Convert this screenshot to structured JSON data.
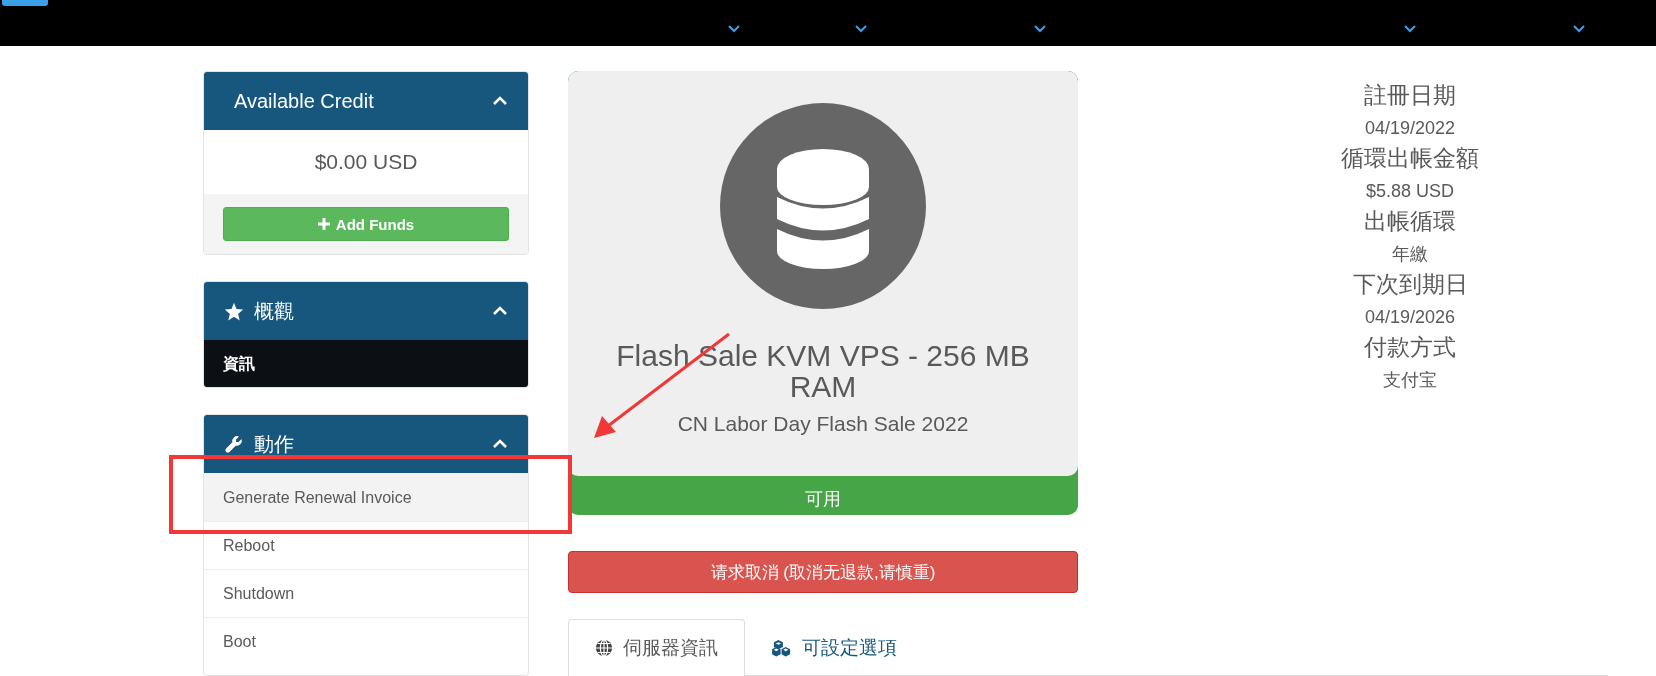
{
  "sidebar": {
    "panels": [
      {
        "kind": "credit",
        "title": "Available Credit",
        "expanded": true,
        "amount": "$0.00 USD",
        "button": "Add Funds"
      },
      {
        "kind": "overview",
        "title": "概觀",
        "expanded": true,
        "items": [
          {
            "label": "資訊",
            "selected": true,
            "highlighted": false
          }
        ]
      },
      {
        "kind": "actions",
        "title": "動作",
        "expanded": true,
        "items": [
          {
            "label": "Generate Renewal Invoice",
            "selected": false,
            "highlighted": true
          },
          {
            "label": "Reboot",
            "selected": false,
            "highlighted": false
          },
          {
            "label": "Shutdown",
            "selected": false,
            "highlighted": false
          },
          {
            "label": "Boot",
            "selected": false,
            "highlighted": false
          }
        ]
      }
    ]
  },
  "product": {
    "title": "Flash Sale KVM VPS - 256 MB RAM",
    "subtitle": "CN Labor Day Flash Sale 2022",
    "status": "可用",
    "cancel_button": "请求取消 (取消无退款,请慎重)"
  },
  "info": [
    {
      "label": "註冊日期",
      "value": "04/19/2022"
    },
    {
      "label": "循環出帳金額",
      "value": "$5.88 USD"
    },
    {
      "label": "出帳循環",
      "value": "年繳"
    },
    {
      "label": "下次到期日",
      "value": "04/19/2026"
    },
    {
      "label": "付款方式",
      "value": "支付宝"
    }
  ],
  "tabs": [
    {
      "label": "伺服器資訊",
      "selected": true,
      "kind": "server"
    },
    {
      "label": "可設定選項",
      "selected": false,
      "kind": "options"
    }
  ],
  "annotations": {
    "highlight_box": true,
    "arrow": true
  }
}
